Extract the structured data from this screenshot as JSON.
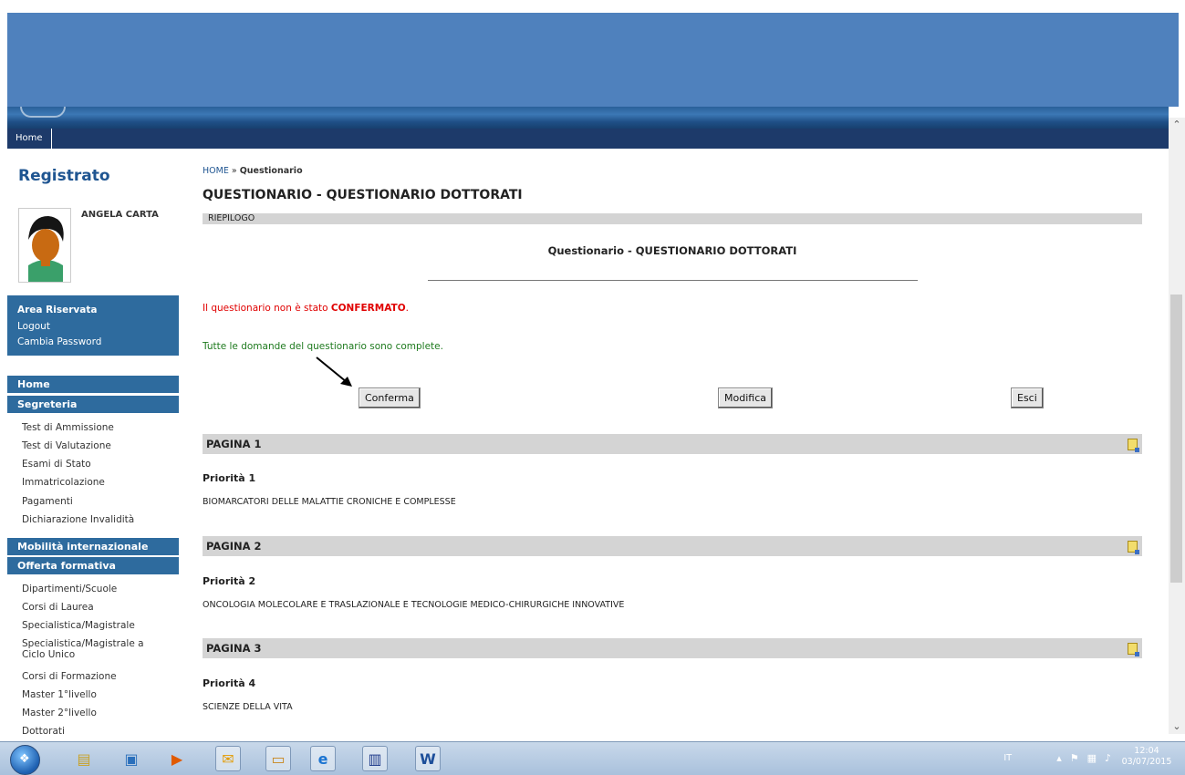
{
  "nav": {
    "home": "Home"
  },
  "sidebar": {
    "title": "Registrato",
    "user_name": "ANGELA CARTA",
    "reserved": {
      "title": "Area Riservata",
      "logout": "Logout",
      "change_password": "Cambia Password"
    },
    "menu_home": "Home",
    "segreteria": {
      "title": "Segreteria",
      "items": [
        "Test di Ammissione",
        "Test di Valutazione",
        "Esami di Stato",
        "Immatricolazione",
        "Pagamenti",
        "Dichiarazione Invalidità"
      ]
    },
    "mobilita": "Mobilità internazionale",
    "offerta": {
      "title": "Offerta formativa",
      "items": [
        "Dipartimenti/Scuole",
        "Corsi di Laurea",
        "Specialistica/Magistrale",
        "Specialistica/Magistrale a",
        "Ciclo Unico",
        "Corsi di Formazione",
        "Master 1°livello",
        "Master 2°livello",
        "Dottorati"
      ]
    }
  },
  "main": {
    "breadcrumb": {
      "home": "HOME",
      "sep": " » ",
      "current": "Questionario"
    },
    "title": "QUESTIONARIO - QUESTIONARIO DOTTORATI",
    "summary_label": "RIEPILOGO",
    "subtitle": "Questionario - QUESTIONARIO DOTTORATI",
    "status_prefix": "Il questionario non è stato ",
    "status_highlight": "CONFERMATO",
    "status_suffix": ".",
    "complete_msg": "Tutte le domande del questionario sono complete.",
    "buttons": {
      "confirm": "Conferma",
      "edit": "Modifica",
      "exit": "Esci"
    },
    "pages": [
      {
        "label": "PAGINA 1",
        "priority": "Priorità 1",
        "answer": "BIOMARCATORI DELLE MALATTIE CRONICHE E COMPLESSE"
      },
      {
        "label": "PAGINA 2",
        "priority": "Priorità 2",
        "answer": "ONCOLOGIA MOLECOLARE E TRASLAZIONALE E TECNOLOGIE MEDICO-CHIRURGICHE INNOVATIVE"
      },
      {
        "label": "PAGINA 3",
        "priority": "Priorità 4",
        "answer": "SCIENZE DELLA VITA"
      }
    ]
  },
  "taskbar": {
    "lang": "IT",
    "time": "12:04",
    "date": "03/07/2015"
  },
  "colors": {
    "banner": "#4f81bd",
    "menu": "#2e6b9e",
    "navbar": "#1d3a6a",
    "alert": "#e00000",
    "ok": "#1e7a1e"
  }
}
